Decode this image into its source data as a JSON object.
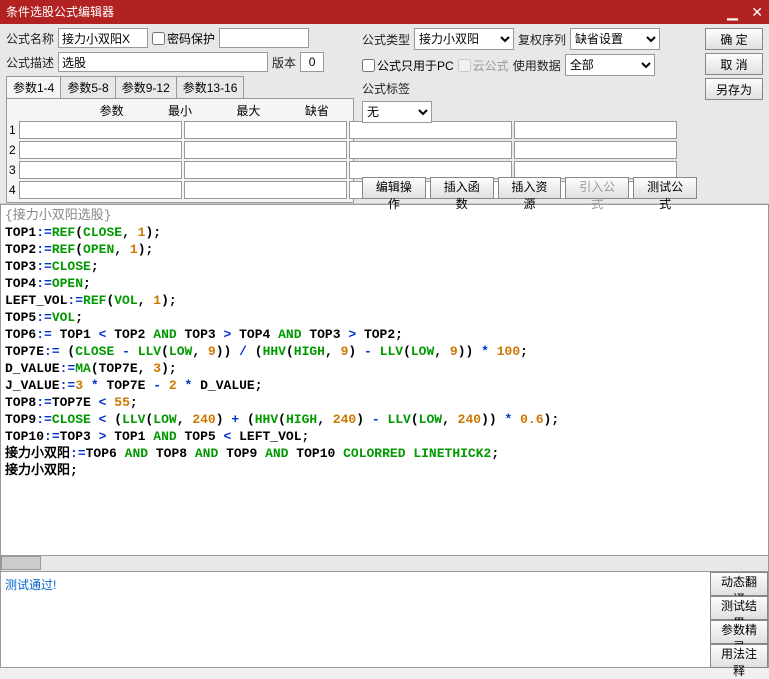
{
  "title": "条件选股公式编辑器",
  "labels": {
    "name": "公式名称",
    "pwd": "密码保护",
    "type": "公式类型",
    "fqseq": "复权序列",
    "desc": "公式描述",
    "ver": "版本",
    "pconly": "公式只用于PC",
    "cloud": "云公式",
    "usedata": "使用数据",
    "tags": "公式标签"
  },
  "fields": {
    "name": "接力小双阳X",
    "desc": "选股",
    "ver": "0",
    "type": "接力小双阳",
    "fqseq": "缺省设置",
    "usedata": "全部",
    "tag": "无"
  },
  "buttons": {
    "ok": "确 定",
    "cancel": "取 消",
    "saveas": "另存为",
    "editop": "编辑操作",
    "insfn": "插入函数",
    "insres": "插入资源",
    "import": "引入公式",
    "test": "测试公式",
    "dyntrans": "动态翻译",
    "testres": "测试结果",
    "paramwiz": "参数精灵",
    "usage": "用法注释"
  },
  "paramTabs": [
    "参数1-4",
    "参数5-8",
    "参数9-12",
    "参数13-16"
  ],
  "paramHdr": [
    "参数",
    "最小",
    "最大",
    "缺省"
  ],
  "paramRows": [
    "1",
    "2",
    "3",
    "4"
  ],
  "status": "测试通过!",
  "code": {
    "titleLine": "{接力小双阳选股}",
    "lines": [
      [
        [
          "txt",
          "TOP1"
        ],
        [
          "op",
          ":="
        ],
        [
          "kw",
          "REF"
        ],
        [
          "txt",
          "("
        ],
        [
          "kw",
          "CLOSE"
        ],
        [
          "txt",
          ", "
        ],
        [
          "num-lit",
          "1"
        ],
        [
          "txt",
          ");"
        ]
      ],
      [
        [
          "txt",
          "TOP2"
        ],
        [
          "op",
          ":="
        ],
        [
          "kw",
          "REF"
        ],
        [
          "txt",
          "("
        ],
        [
          "kw",
          "OPEN"
        ],
        [
          "txt",
          ", "
        ],
        [
          "num-lit",
          "1"
        ],
        [
          "txt",
          ");"
        ]
      ],
      [
        [
          "txt",
          "TOP3"
        ],
        [
          "op",
          ":="
        ],
        [
          "kw",
          "CLOSE"
        ],
        [
          "txt",
          ";"
        ]
      ],
      [
        [
          "txt",
          "TOP4"
        ],
        [
          "op",
          ":="
        ],
        [
          "kw",
          "OPEN"
        ],
        [
          "txt",
          ";"
        ]
      ],
      [
        [
          "txt",
          "LEFT_VOL"
        ],
        [
          "op",
          ":="
        ],
        [
          "kw",
          "REF"
        ],
        [
          "txt",
          "("
        ],
        [
          "kw",
          "VOL"
        ],
        [
          "txt",
          ", "
        ],
        [
          "num-lit",
          "1"
        ],
        [
          "txt",
          ");"
        ]
      ],
      [
        [
          "txt",
          "TOP5"
        ],
        [
          "op",
          ":="
        ],
        [
          "kw",
          "VOL"
        ],
        [
          "txt",
          ";"
        ]
      ],
      [
        [
          "txt",
          "TOP6"
        ],
        [
          "op",
          ":="
        ],
        [
          "txt",
          " TOP1 "
        ],
        [
          "op",
          "<"
        ],
        [
          "txt",
          " TOP2 "
        ],
        [
          "kw",
          "AND"
        ],
        [
          "txt",
          " TOP3 "
        ],
        [
          "op",
          ">"
        ],
        [
          "txt",
          " TOP4 "
        ],
        [
          "kw",
          "AND"
        ],
        [
          "txt",
          " TOP3 "
        ],
        [
          "op",
          ">"
        ],
        [
          "txt",
          " TOP2;"
        ]
      ],
      [
        [
          "txt",
          "TOP7E"
        ],
        [
          "op",
          ":="
        ],
        [
          "txt",
          " ("
        ],
        [
          "kw",
          "CLOSE"
        ],
        [
          "txt",
          " "
        ],
        [
          "op",
          "-"
        ],
        [
          "txt",
          " "
        ],
        [
          "kw",
          "LLV"
        ],
        [
          "txt",
          "("
        ],
        [
          "kw",
          "LOW"
        ],
        [
          "txt",
          ", "
        ],
        [
          "num-lit",
          "9"
        ],
        [
          "txt",
          ")) "
        ],
        [
          "op",
          "/"
        ],
        [
          "txt",
          " ("
        ],
        [
          "kw",
          "HHV"
        ],
        [
          "txt",
          "("
        ],
        [
          "kw",
          "HIGH"
        ],
        [
          "txt",
          ", "
        ],
        [
          "num-lit",
          "9"
        ],
        [
          "txt",
          ") "
        ],
        [
          "op",
          "-"
        ],
        [
          "txt",
          " "
        ],
        [
          "kw",
          "LLV"
        ],
        [
          "txt",
          "("
        ],
        [
          "kw",
          "LOW"
        ],
        [
          "txt",
          ", "
        ],
        [
          "num-lit",
          "9"
        ],
        [
          "txt",
          ")) "
        ],
        [
          "op",
          "*"
        ],
        [
          "txt",
          " "
        ],
        [
          "num-lit",
          "100"
        ],
        [
          "txt",
          ";"
        ]
      ],
      [
        [
          "txt",
          "D_VALUE"
        ],
        [
          "op",
          ":="
        ],
        [
          "kw",
          "MA"
        ],
        [
          "txt",
          "(TOP7E, "
        ],
        [
          "num-lit",
          "3"
        ],
        [
          "txt",
          ");"
        ]
      ],
      [
        [
          "txt",
          "J_VALUE"
        ],
        [
          "op",
          ":="
        ],
        [
          "num-lit",
          "3"
        ],
        [
          "txt",
          " "
        ],
        [
          "op",
          "*"
        ],
        [
          "txt",
          " TOP7E "
        ],
        [
          "op",
          "-"
        ],
        [
          "txt",
          " "
        ],
        [
          "num-lit",
          "2"
        ],
        [
          "txt",
          " "
        ],
        [
          "op",
          "*"
        ],
        [
          "txt",
          " D_VALUE;"
        ]
      ],
      [
        [
          "txt",
          "TOP8"
        ],
        [
          "op",
          ":="
        ],
        [
          "txt",
          "TOP7E "
        ],
        [
          "op",
          "<"
        ],
        [
          "txt",
          " "
        ],
        [
          "num-lit",
          "55"
        ],
        [
          "txt",
          ";"
        ]
      ],
      [
        [
          "txt",
          "TOP9"
        ],
        [
          "op",
          ":="
        ],
        [
          "kw",
          "CLOSE"
        ],
        [
          "txt",
          " "
        ],
        [
          "op",
          "<"
        ],
        [
          "txt",
          " ("
        ],
        [
          "kw",
          "LLV"
        ],
        [
          "txt",
          "("
        ],
        [
          "kw",
          "LOW"
        ],
        [
          "txt",
          ", "
        ],
        [
          "num-lit",
          "240"
        ],
        [
          "txt",
          ") "
        ],
        [
          "op",
          "+"
        ],
        [
          "txt",
          " ("
        ],
        [
          "kw",
          "HHV"
        ],
        [
          "txt",
          "("
        ],
        [
          "kw",
          "HIGH"
        ],
        [
          "txt",
          ", "
        ],
        [
          "num-lit",
          "240"
        ],
        [
          "txt",
          ") "
        ],
        [
          "op",
          "-"
        ],
        [
          "txt",
          " "
        ],
        [
          "kw",
          "LLV"
        ],
        [
          "txt",
          "("
        ],
        [
          "kw",
          "LOW"
        ],
        [
          "txt",
          ", "
        ],
        [
          "num-lit",
          "240"
        ],
        [
          "txt",
          ")) "
        ],
        [
          "op",
          "*"
        ],
        [
          "txt",
          " "
        ],
        [
          "num-lit",
          "0.6"
        ],
        [
          "txt",
          ");"
        ]
      ],
      [
        [
          "txt",
          "TOP10"
        ],
        [
          "op",
          ":="
        ],
        [
          "txt",
          "TOP3 "
        ],
        [
          "op",
          ">"
        ],
        [
          "txt",
          " TOP1 "
        ],
        [
          "kw",
          "AND"
        ],
        [
          "txt",
          " TOP5 "
        ],
        [
          "op",
          "<"
        ],
        [
          "txt",
          " LEFT_VOL;"
        ]
      ],
      [
        [
          "txt",
          "接力小双阳"
        ],
        [
          "op",
          ":="
        ],
        [
          "txt",
          "TOP6 "
        ],
        [
          "kw",
          "AND"
        ],
        [
          "txt",
          " TOP8 "
        ],
        [
          "kw",
          "AND"
        ],
        [
          "txt",
          " TOP9 "
        ],
        [
          "kw",
          "AND"
        ],
        [
          "txt",
          " TOP10 "
        ],
        [
          "kw",
          "COLORRED"
        ],
        [
          "txt",
          " "
        ],
        [
          "kw",
          "LINETHICK2"
        ],
        [
          "txt",
          ";"
        ]
      ],
      [
        [
          "txt",
          "接力小双阳;"
        ]
      ]
    ]
  }
}
